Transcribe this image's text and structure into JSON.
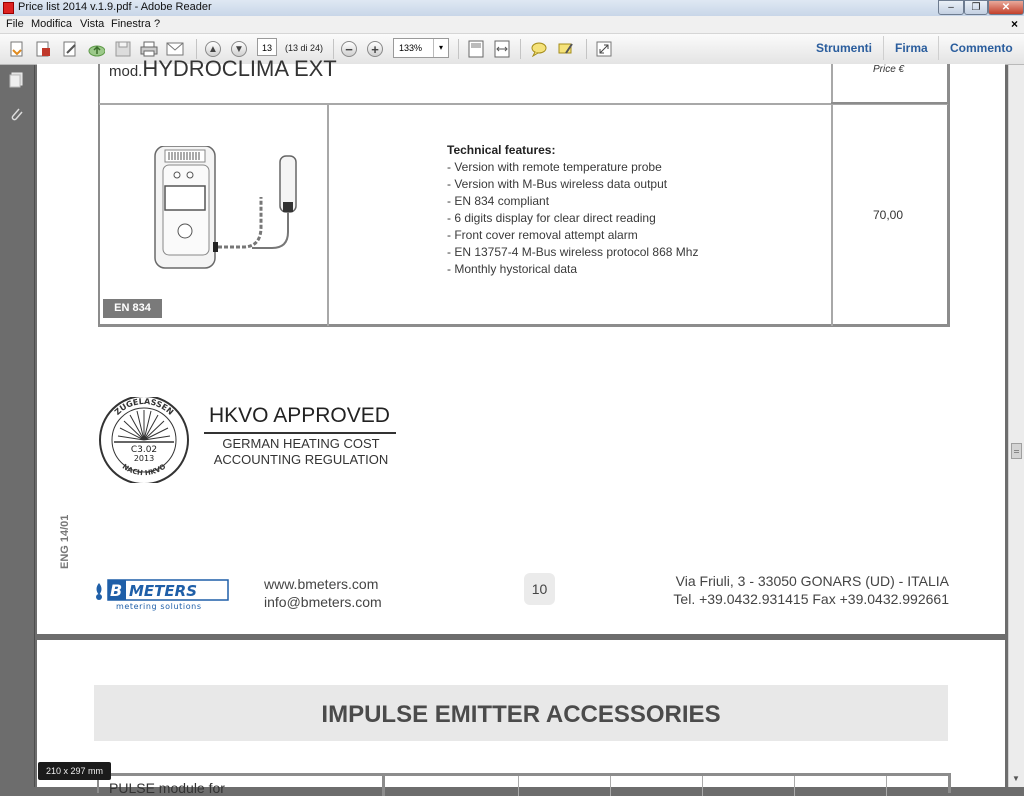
{
  "window": {
    "title": "Price list 2014 v.1.9.pdf - Adobe Reader"
  },
  "menu": {
    "items": [
      "File",
      "Modifica",
      "Vista",
      "Finestra",
      "?"
    ],
    "close_glyph": "×"
  },
  "toolbar": {
    "page_input": "13",
    "page_count": "(13 di 24)",
    "zoom": "133%",
    "zoom_dropdown": "▾",
    "right_tabs": [
      "Strumenti",
      "Firma",
      "Commento"
    ]
  },
  "product": {
    "model_prefix": "mod.",
    "model_name": "HYDROCLIMA EXT",
    "price_header": "Price €",
    "features_title": "Technical features:",
    "features": [
      "- Version with remote temperature probe",
      "- Version with M-Bus wireless data output",
      "- EN 834 compliant",
      "- 6 digits display for clear direct reading",
      "- Front cover removal attempt alarm",
      "- EN 13757-4 M-Bus wireless protocol 868 Mhz",
      "- Monthly hystorical data"
    ],
    "price": "70,00",
    "badge": "EN 834"
  },
  "hkvo": {
    "title": "HKVO APPROVED",
    "subtitle_line1": "GERMAN HEATING COST",
    "subtitle_line2": "ACCOUNTING REGULATION",
    "seal_top": "ZUGELASSEN",
    "seal_code": "C3.02",
    "seal_year": "2013",
    "seal_bottom": "NACH HKVO"
  },
  "footer": {
    "doc_code": "ENG 14/01",
    "logo_text": "B METERS",
    "logo_sub": "metering solutions",
    "website": "www.bmeters.com",
    "email": "info@bmeters.com",
    "page_number": "10",
    "address": "Via Friuli, 3 - 33050 GONARS (UD) - ITALIA",
    "phone": "Tel. +39.0432.931415  Fax +39.0432.992661"
  },
  "page2": {
    "section_title": "IMPULSE EMITTER ACCESSORIES",
    "table_label": "PULSE module for"
  },
  "status": {
    "page_size": "210 x 297 mm"
  },
  "colors": {
    "link_blue": "#2a5d9d",
    "badge_gray": "#7a7a7a",
    "logo_blue": "#1f5fa8"
  },
  "icons": [
    "pdf-app-icon",
    "open-icon",
    "create-icon",
    "edit-icon",
    "cloud-icon",
    "save-icon",
    "print-icon",
    "email-icon",
    "page-up-icon",
    "page-down-icon",
    "zoom-out-icon",
    "zoom-in-icon",
    "fit-page-icon",
    "fit-width-icon",
    "comment-icon",
    "highlight-icon",
    "fullscreen-icon",
    "pages-panel-icon",
    "attachments-icon"
  ]
}
